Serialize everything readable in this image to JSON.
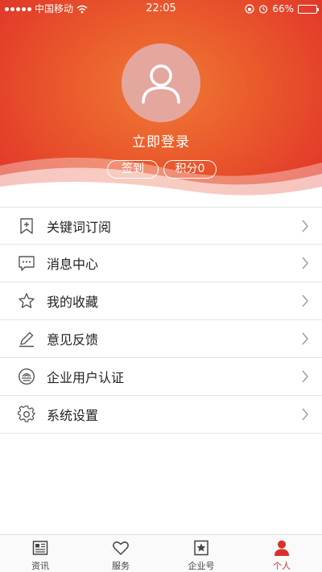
{
  "status_bar": {
    "carrier": "中国移动",
    "time": "22:05",
    "battery": "66%",
    "battery_level": 0.66
  },
  "profile": {
    "avatar_icon": "user-icon",
    "login_label": "立即登录",
    "sign_in_label": "签到",
    "points_label": "积分0"
  },
  "menu": {
    "items": [
      {
        "label": "关键词订阅",
        "icon": "bookmark-add-icon"
      },
      {
        "label": "消息中心",
        "icon": "message-icon"
      },
      {
        "label": "我的收藏",
        "icon": "star-icon"
      },
      {
        "label": "意见反馈",
        "icon": "pencil-icon"
      },
      {
        "label": "企业用户认证",
        "icon": "enterprise-badge-icon"
      },
      {
        "label": "系统设置",
        "icon": "gear-icon"
      }
    ]
  },
  "tabbar": {
    "items": [
      {
        "label": "资讯",
        "icon": "news-icon"
      },
      {
        "label": "服务",
        "icon": "heart-icon"
      },
      {
        "label": "企业号",
        "icon": "star-badge-icon"
      },
      {
        "label": "个人",
        "icon": "person-icon"
      }
    ],
    "active_index": 3
  },
  "colors": {
    "header_red": "#e1342a",
    "header_orange": "#f07a34",
    "active_tab": "#d9312a",
    "avatar_bg": "#e3a79e"
  }
}
